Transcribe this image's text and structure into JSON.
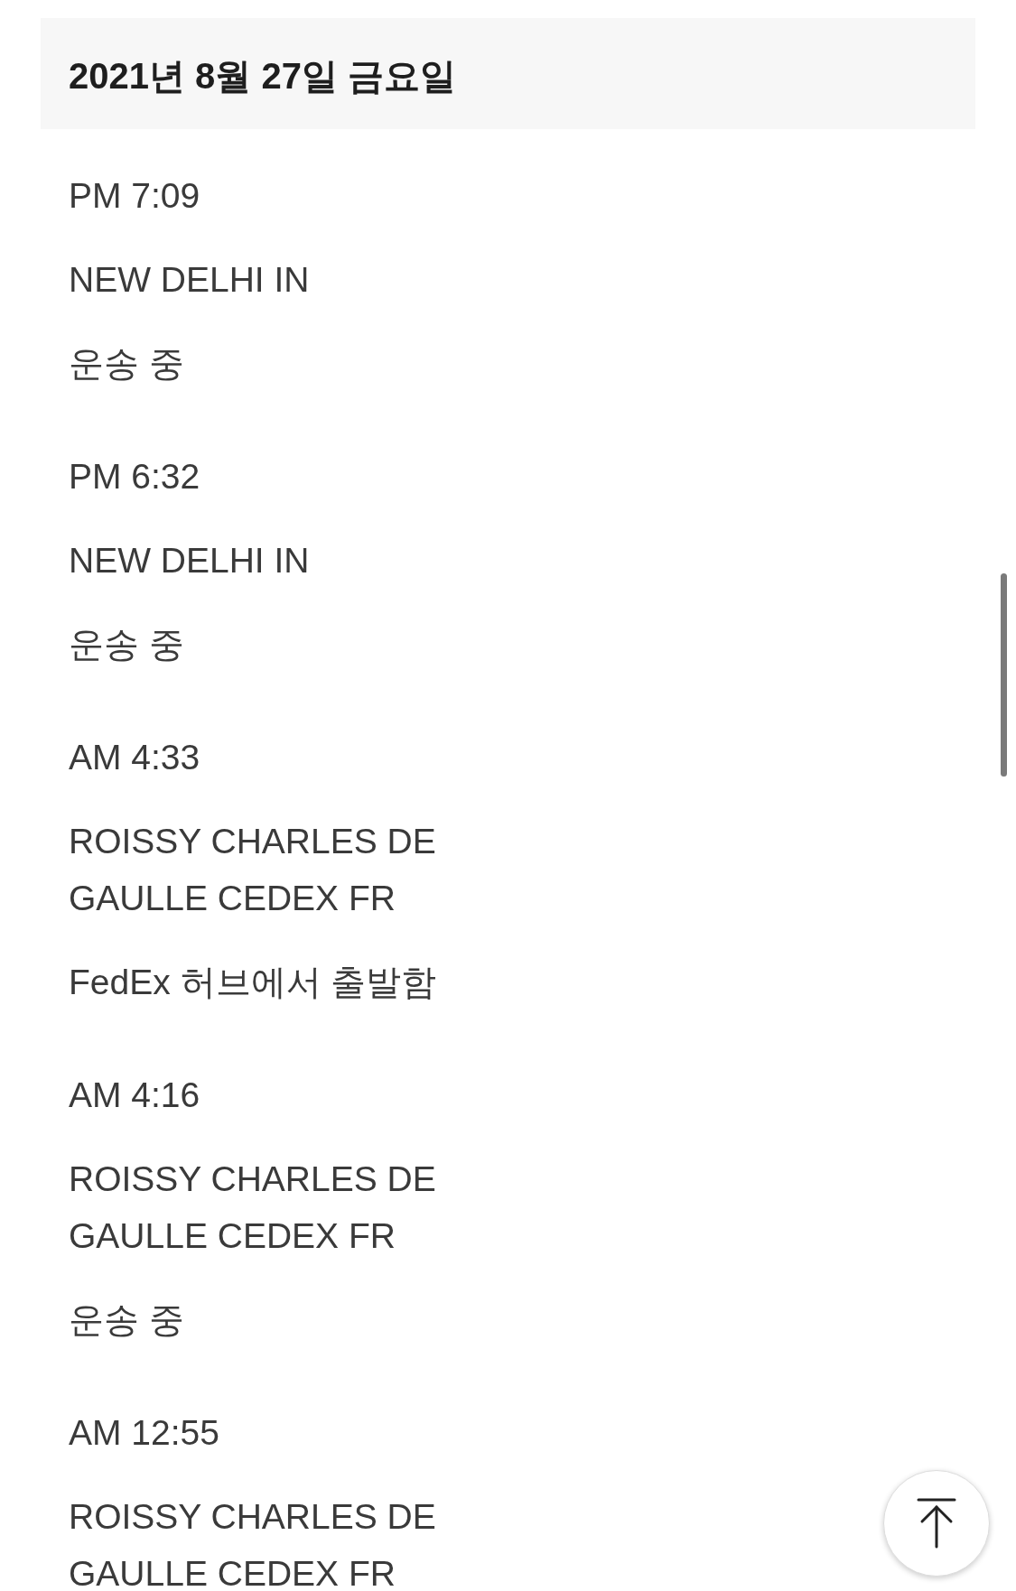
{
  "date_header": "2021년 8월 27일 금요일",
  "events": [
    {
      "time": "PM 7:09",
      "location": "NEW DELHI IN",
      "status": "운송 중"
    },
    {
      "time": "PM 6:32",
      "location": "NEW DELHI IN",
      "status": "운송 중"
    },
    {
      "time": "AM 4:33",
      "location": "ROISSY CHARLES DE GAULLE CEDEX FR",
      "status": "FedEx 허브에서 출발함"
    },
    {
      "time": "AM 4:16",
      "location": "ROISSY CHARLES DE GAULLE CEDEX FR",
      "status": "운송 중"
    },
    {
      "time": "AM 12:55",
      "location": "ROISSY CHARLES DE GAULLE CEDEX FR"
    }
  ]
}
